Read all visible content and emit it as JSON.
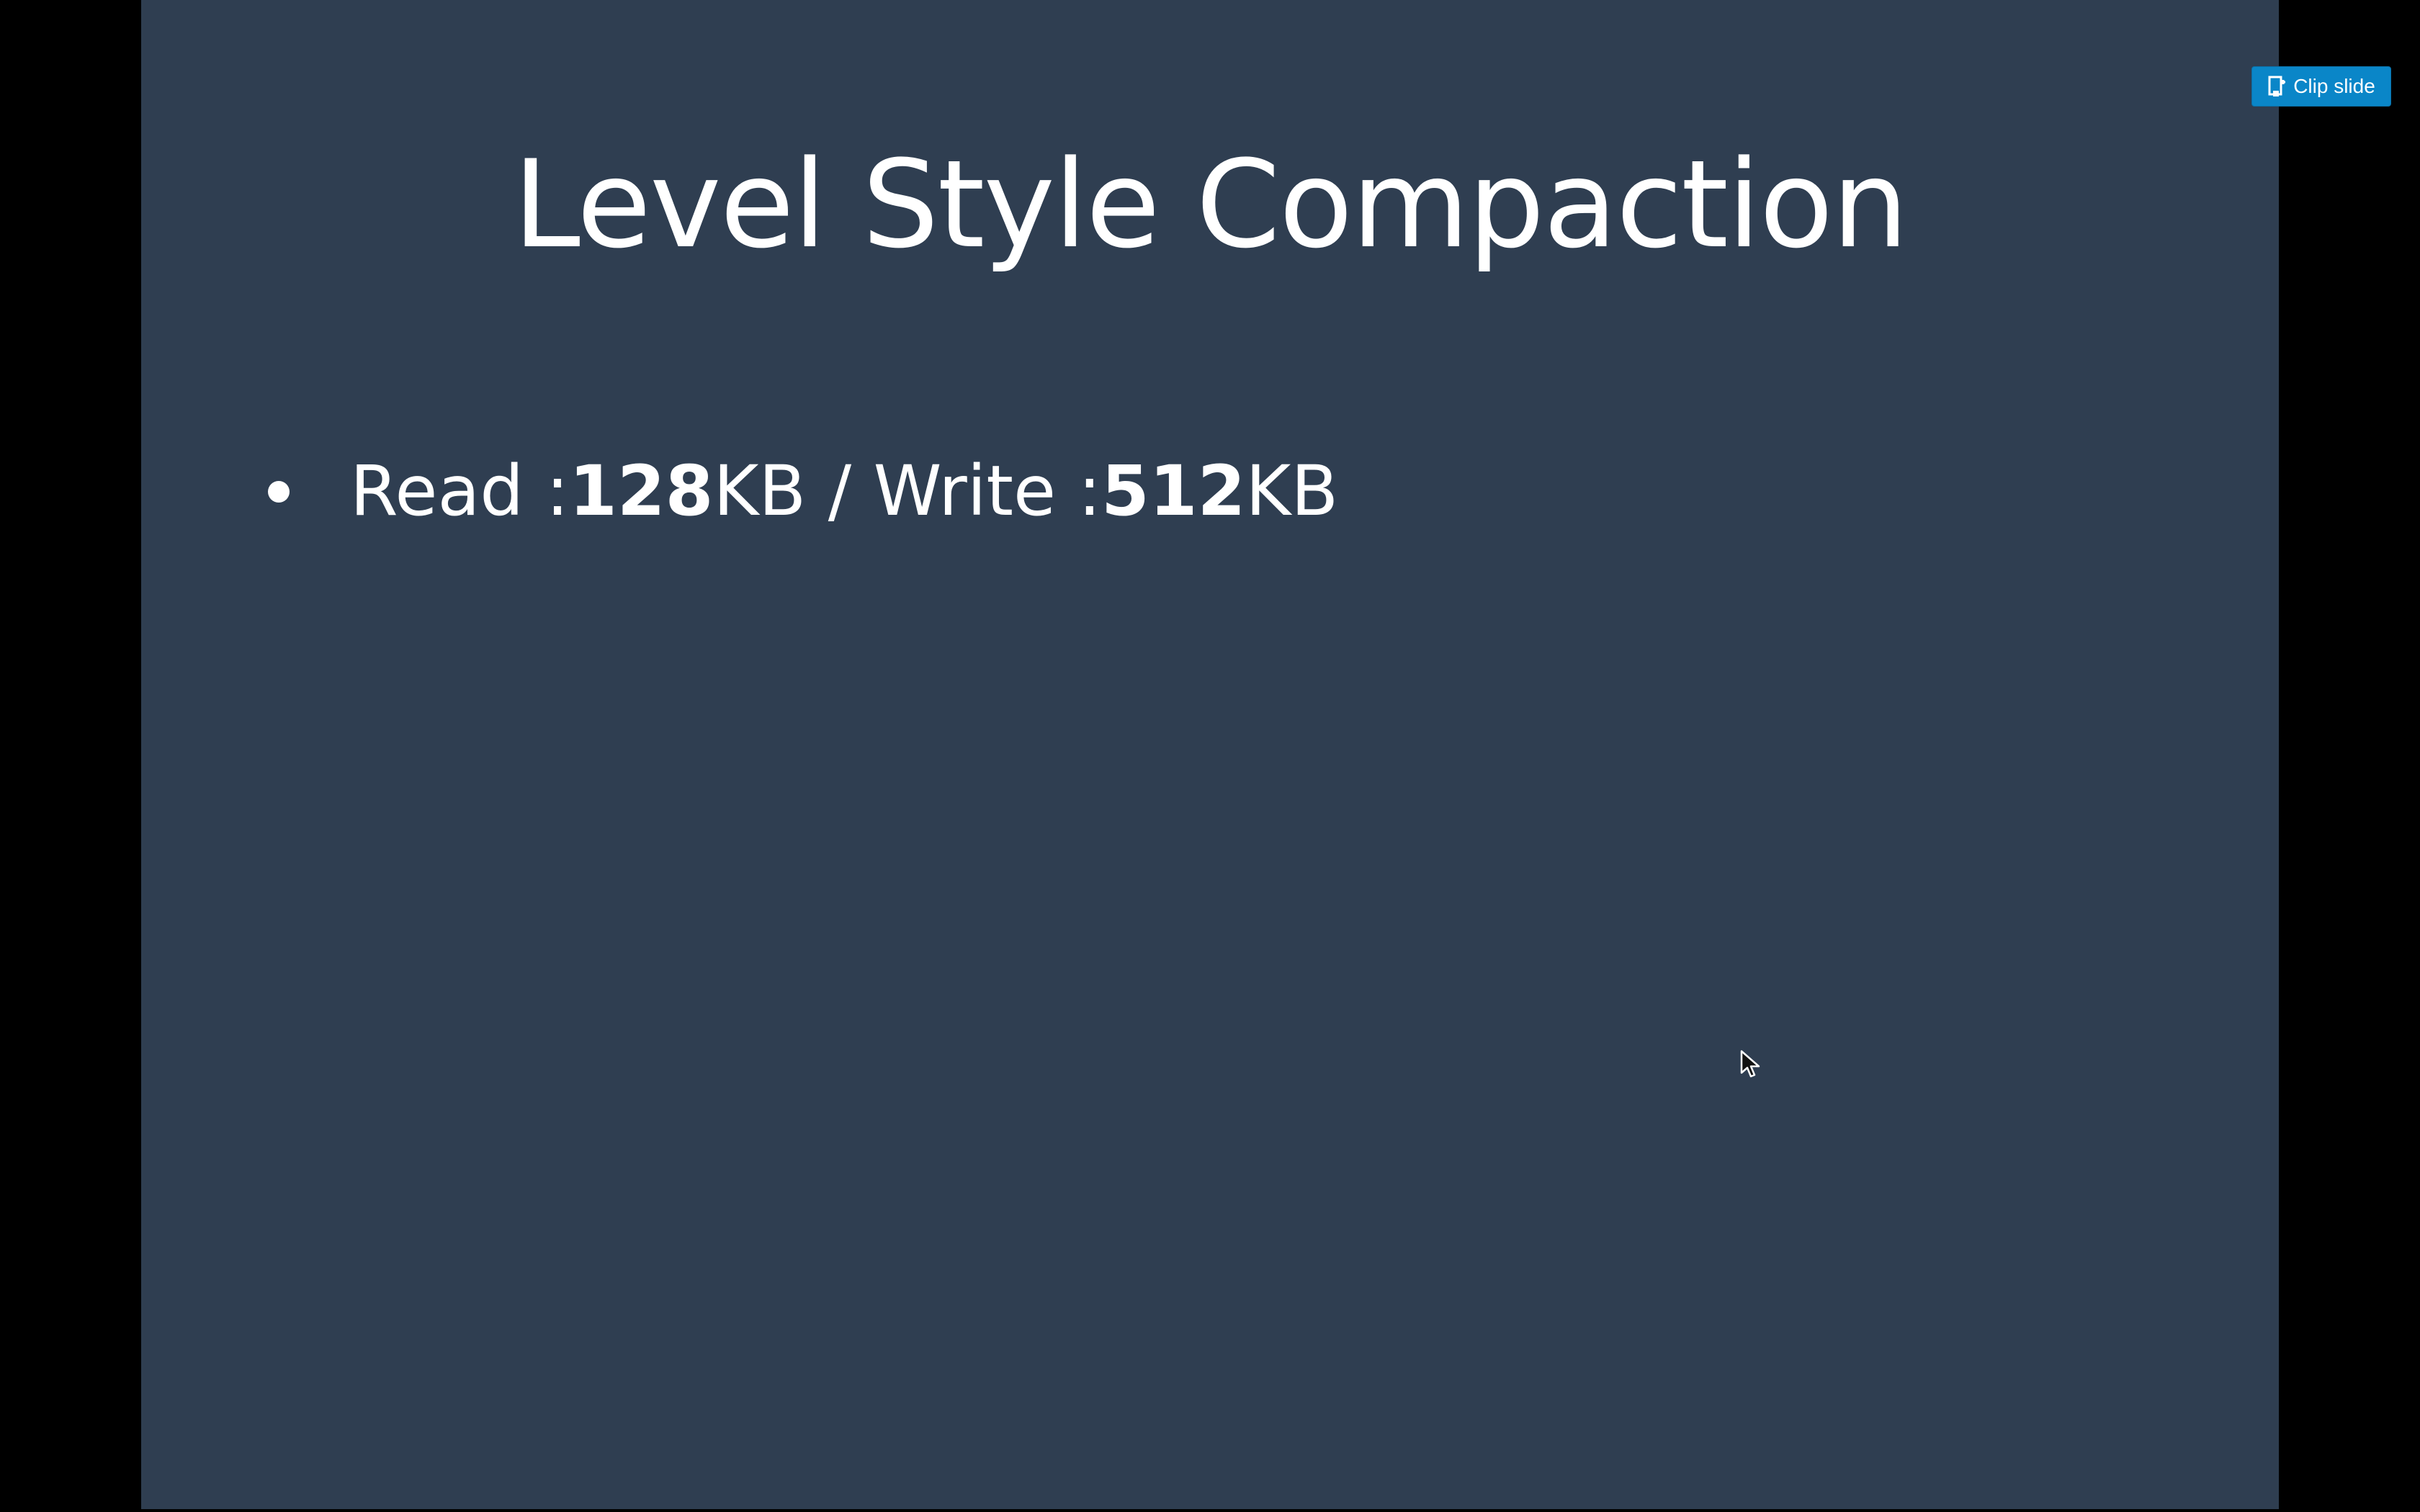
{
  "slide": {
    "title": "Level Style Compaction",
    "bullets": [
      {
        "parts": {
          "read_label": "Read : ",
          "read_value": "128",
          "read_unit": "KB / Write : ",
          "write_value": "512",
          "write_unit": "KB"
        }
      }
    ],
    "background_color": "#2f3e51",
    "text_color": "#ffffff"
  },
  "toolbar": {
    "clip_label": "Clip slide",
    "clip_icon": "clip-slide-icon",
    "accent_color": "#0a86c8"
  },
  "cursor": {
    "icon": "mouse-pointer-icon"
  }
}
